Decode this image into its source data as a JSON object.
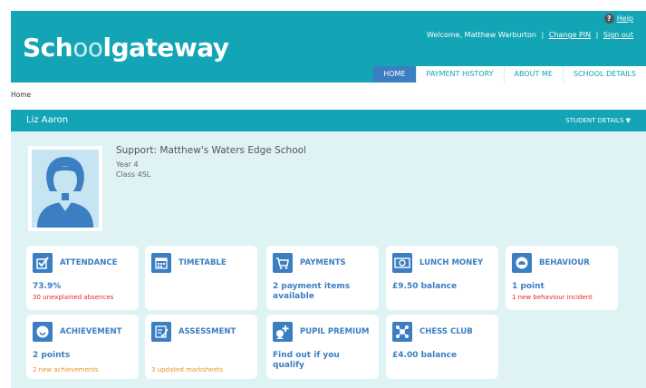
{
  "header": {
    "logo_part1": "Sch",
    "logo_part2": "oo",
    "logo_part3": "lgateway",
    "help_label": "Help",
    "welcome_text": "Welcome, Matthew Warburton",
    "change_pin_label": "Change PIN",
    "sign_out_label": "Sign out",
    "separator": "|"
  },
  "tabs": [
    {
      "label": "HOME",
      "active": true
    },
    {
      "label": "PAYMENT HISTORY",
      "active": false
    },
    {
      "label": "ABOUT ME",
      "active": false
    },
    {
      "label": "SCHOOL DETAILS",
      "active": false
    }
  ],
  "breadcrumb": "Home",
  "student": {
    "name": "Liz Aaron",
    "details_label": "STUDENT DETAILS ▼",
    "support": "Support: Matthew's Waters Edge School",
    "year": "Year 4",
    "class": "Class 4SL"
  },
  "tiles": [
    {
      "title": "ATTENDANCE",
      "icon": "checkbox-icon",
      "value": "73.9%",
      "note": "30 unexplained absences",
      "note_color": "red"
    },
    {
      "title": "TIMETABLE",
      "icon": "calendar-icon",
      "value": "",
      "note": ""
    },
    {
      "title": "PAYMENTS",
      "icon": "cart-icon",
      "value": "2 payment items available",
      "note": ""
    },
    {
      "title": "LUNCH MONEY",
      "icon": "money-icon",
      "value": "£9.50 balance",
      "note": ""
    },
    {
      "title": "BEHAVIOUR",
      "icon": "gauge-icon",
      "value": "1 point",
      "note": "1 new behaviour incident",
      "note_color": "red"
    },
    {
      "title": "ACHIEVEMENT",
      "icon": "smiley-icon",
      "value": "2 points",
      "note": "2 new achievements",
      "note_color": "orange"
    },
    {
      "title": "ASSESSMENT",
      "icon": "clipboard-check-icon",
      "value": "",
      "note": "3 updated marksheets",
      "note_color": "orange"
    },
    {
      "title": "PUPIL PREMIUM",
      "icon": "pupil-plus-icon",
      "value": "Find out if you qualify",
      "note": ""
    },
    {
      "title": "CHESS CLUB",
      "icon": "club-icon",
      "value": "£4.00 balance",
      "note": ""
    }
  ],
  "colors": {
    "brand_teal": "#13a5b5",
    "accent_blue": "#3b7ec2",
    "panel_bg": "#dff2f4",
    "alert_red": "#e02b1c",
    "notice_orange": "#e8942b"
  }
}
